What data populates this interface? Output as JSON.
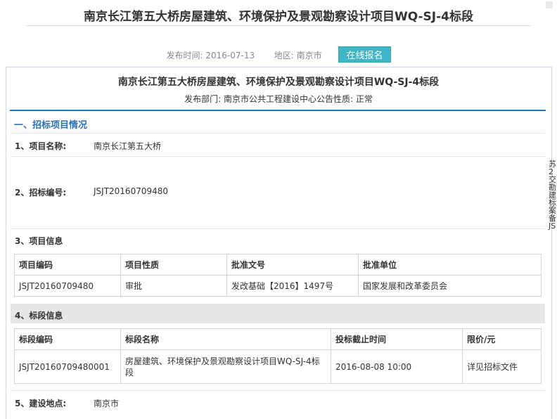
{
  "header": {
    "title": "南京长江第五大桥房屋建筑、环境保护及景观勘察设计项目WQ-SJ-4标段",
    "publish_time_label": "发布时间:",
    "publish_time": "2016-07-13",
    "region_label": "地区:",
    "region": "南京市",
    "online_signup": "在线报名"
  },
  "notice": {
    "title": "南京长江第五大桥房屋建筑、环境保护及景观勘察设计项目WQ-SJ-4标段",
    "dept_line": "发布部门:  南京市公共工程建设中心公告性质:   正常"
  },
  "section1": {
    "heading": "一、招标项目情况"
  },
  "project_name": {
    "label": "1、项目名称:",
    "value": "南京长江第五大桥"
  },
  "bid_no": {
    "label": "2、招标编号:",
    "value": "JSJT20160709480"
  },
  "project_info": {
    "label": "3、项目信息",
    "headers": [
      "项目编码",
      "项目性质",
      "批准文号",
      "批准单位"
    ],
    "row": [
      "JSJT20160709480",
      "审批",
      "发改基础【2016】1497号",
      "国家发展和改革委员会"
    ]
  },
  "section_info": {
    "label": "4、标段信息",
    "headers": [
      "标段编码",
      "标段名称",
      "投标截止时间",
      "限价/元"
    ],
    "row": [
      "JSJT20160709480001",
      "房屋建筑、环境保护及景观勘察设计项目WQ-SJ-4标段",
      "2016-08-08 10:00",
      "详见招标文件"
    ]
  },
  "location": {
    "label": "5、建设地点:",
    "value": "南京市"
  },
  "side_text": "苏2交勘建标案备JS"
}
